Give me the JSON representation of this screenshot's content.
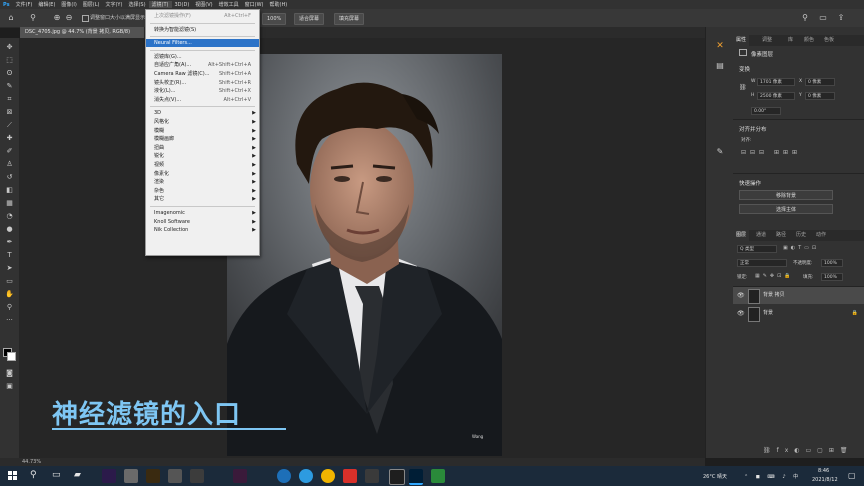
{
  "menubar": {
    "items": [
      "Ps",
      "文件(F)",
      "编辑(E)",
      "图像(I)",
      "图层(L)",
      "文字(Y)",
      "选择(S)",
      "滤镜(T)",
      "3D(D)",
      "视图(V)",
      "增效工具",
      "窗口(W)",
      "帮助(H)"
    ],
    "active_index": 7
  },
  "options_bar": {
    "zoom_pct": "100%",
    "fit_label": "适合屏幕",
    "fill_label": "填充屏幕",
    "resize_text": "调整窗口大小以满屏显示",
    "scrubby_text": "细微缩放"
  },
  "document": {
    "tab_title": "DSC_4705.jpg @ 44.7% (背景 拷贝, RGB/8)",
    "overlay_text": "神经滤镜的入口",
    "signature": "Wang"
  },
  "filter_menu": {
    "items": [
      {
        "label": "上次滤镜操作(F)",
        "shortcut": "Alt+Ctrl+F",
        "disabled": true
      },
      {
        "sep": true
      },
      {
        "label": "转换为智能滤镜(S)"
      },
      {
        "sep": true
      },
      {
        "label": "Neural Filters...",
        "highlighted": true
      },
      {
        "sep": true
      },
      {
        "label": "滤镜库(G)..."
      },
      {
        "label": "自适应广角(A)...",
        "shortcut": "Alt+Shift+Ctrl+A"
      },
      {
        "label": "Camera Raw 滤镜(C)...",
        "shortcut": "Shift+Ctrl+A"
      },
      {
        "label": "镜头校正(R)...",
        "shortcut": "Shift+Ctrl+R"
      },
      {
        "label": "液化(L)...",
        "shortcut": "Shift+Ctrl+X"
      },
      {
        "label": "消失点(V)...",
        "shortcut": "Alt+Ctrl+V"
      },
      {
        "sep": true
      },
      {
        "label": "3D",
        "submenu": true
      },
      {
        "label": "风格化",
        "submenu": true
      },
      {
        "label": "模糊",
        "submenu": true
      },
      {
        "label": "模糊画廊",
        "submenu": true
      },
      {
        "label": "扭曲",
        "submenu": true
      },
      {
        "label": "锐化",
        "submenu": true
      },
      {
        "label": "视频",
        "submenu": true
      },
      {
        "label": "像素化",
        "submenu": true
      },
      {
        "label": "渲染",
        "submenu": true
      },
      {
        "label": "杂色",
        "submenu": true
      },
      {
        "label": "其它",
        "submenu": true
      },
      {
        "sep": true
      },
      {
        "label": "Imagenomic",
        "submenu": true
      },
      {
        "label": "Knoll Software",
        "submenu": true
      },
      {
        "label": "Nik Collection",
        "submenu": true
      }
    ]
  },
  "status_bar": {
    "zoom": "44.73%"
  },
  "properties_panel": {
    "tabs": [
      "属性",
      "调整",
      "库",
      "颜色",
      "色板"
    ],
    "title": "像素图层",
    "transform_label": "变换",
    "w_label": "W",
    "w_value": "1701 像素",
    "h_label": "H",
    "h_value": "2500 像素",
    "x_label": "X",
    "x_value": "0 像素",
    "y_label": "Y",
    "y_value": "0 像素",
    "angle_value": "0.00°",
    "align_label": "对齐并分布",
    "align_sub": "对齐:",
    "quick_label": "快速操作",
    "remove_bg": "移除背景",
    "select_subject": "选择主体"
  },
  "layers_panel": {
    "tabs": [
      "图层",
      "通道",
      "路径",
      "历史",
      "动作"
    ],
    "kind_label": "Q 类型",
    "blend_mode": "正常",
    "opacity_label": "不透明度:",
    "opacity_value": "100%",
    "lock_label": "锁定:",
    "fill_label": "填充:",
    "fill_value": "100%",
    "layers": [
      {
        "name": "背景 拷贝",
        "selected": true
      },
      {
        "name": "背景",
        "locked": true
      }
    ]
  },
  "taskbar": {
    "weather": "26°C 晴天",
    "time": "8:46",
    "date": "2021/8/12"
  }
}
